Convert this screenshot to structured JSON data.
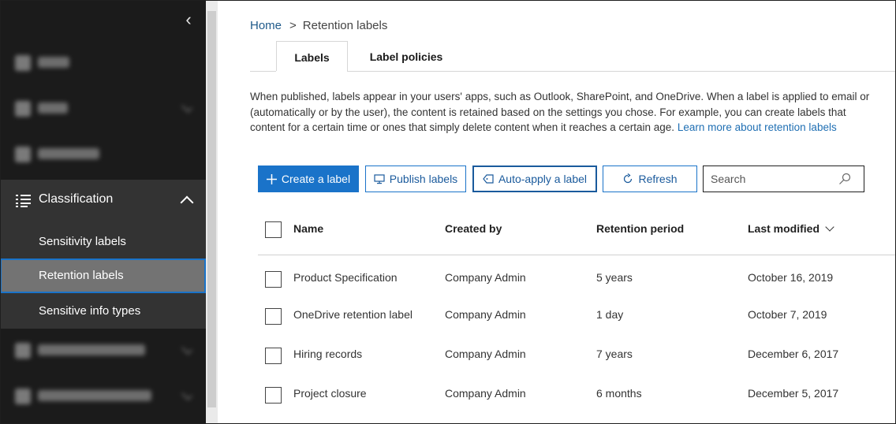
{
  "sidebar": {
    "blurred_items_top": [
      "Home",
      "Alerts",
      "Permissions"
    ],
    "classification": {
      "label": "Classification",
      "items": [
        {
          "label": "Sensitivity labels",
          "active": false
        },
        {
          "label": "Retention labels",
          "active": true
        },
        {
          "label": "Sensitive info types",
          "active": false
        }
      ]
    },
    "blurred_items_bottom": [
      "Data loss prevention",
      "Records management"
    ]
  },
  "breadcrumb": {
    "home": "Home",
    "separator": ">",
    "current": "Retention labels"
  },
  "tabs": [
    {
      "label": "Labels",
      "active": true
    },
    {
      "label": "Label policies",
      "active": false
    }
  ],
  "description": {
    "line1": "When published, labels appear in your users' apps, such as Outlook, SharePoint, and OneDrive. When a label is applied to email or",
    "line2": "(automatically or by the user), the content is retained based on the settings you chose. For example, you can create labels that",
    "line3": "content for a certain time or ones that simply delete content when it reaches a certain age.",
    "learn_more": "Learn more about retention labels"
  },
  "toolbar": {
    "create": "Create a label",
    "publish": "Publish labels",
    "auto_apply": "Auto-apply a label",
    "refresh": "Refresh",
    "search_placeholder": "Search"
  },
  "table": {
    "columns": [
      "Name",
      "Created by",
      "Retention period",
      "Last modified"
    ],
    "sorted_column": "Last modified",
    "rows": [
      {
        "name": "Product Specification",
        "created_by": "Company Admin",
        "retention": "5 years",
        "modified": "October 16, 2019"
      },
      {
        "name": "OneDrive retention label",
        "created_by": "Company Admin",
        "retention": "1 day",
        "modified": "October 7, 2019"
      },
      {
        "name": "Hiring records",
        "created_by": "Company Admin",
        "retention": "7 years",
        "modified": "December 6, 2017"
      },
      {
        "name": "Project closure",
        "created_by": "Company Admin",
        "retention": "6 months",
        "modified": "December 5, 2017"
      }
    ]
  },
  "colors": {
    "sidebar_bg": "#1b1b1b",
    "section_bg": "#333333",
    "active_item_bg": "#737373",
    "accent": "#1a73c9",
    "link": "#1f6fb3"
  }
}
